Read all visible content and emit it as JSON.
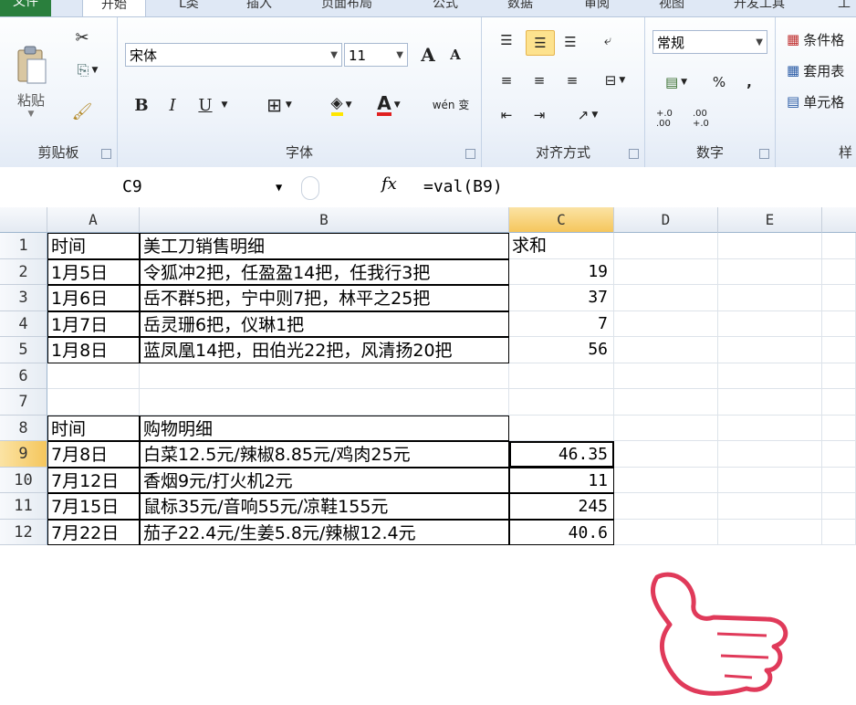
{
  "ribbon": {
    "tabs": [
      "文件",
      "开始",
      "L类",
      "插入",
      "页面布局",
      "公式",
      "数据",
      "审阅",
      "视图",
      "开发工具",
      "工"
    ],
    "clipboard": {
      "paste_label": "粘贴",
      "group_label": "剪贴板"
    },
    "font": {
      "name": "宋体",
      "size": "11",
      "bold": "B",
      "italic": "I",
      "underline": "U",
      "color_glyph": "A",
      "wen_glyph": "wén 变",
      "group_label": "字体",
      "grow": "A",
      "shrink": "A"
    },
    "alignment": {
      "group_label": "对齐方式"
    },
    "number": {
      "format": "常规",
      "percent": "%",
      "comma": ",",
      "inc_dec": "+.0 .00",
      "dec_dec": ".00 +.0",
      "group_label": "数字"
    },
    "styles": {
      "cond_label": "条件格",
      "table_label": "套用表",
      "cell_label": "单元格",
      "group_label": "样"
    }
  },
  "formula_bar": {
    "name_box": "C9",
    "fx": "fx",
    "formula": "=val(B9)"
  },
  "sheet": {
    "columns": [
      "A",
      "B",
      "C",
      "D",
      "E"
    ],
    "active_column": "C",
    "active_row": "9",
    "rows": [
      {
        "num": "1",
        "a": "时间",
        "b": "美工刀销售明细",
        "c": "求和"
      },
      {
        "num": "2",
        "a": "1月5日",
        "b": "令狐冲2把，任盈盈14把，任我行3把",
        "c": "19"
      },
      {
        "num": "3",
        "a": "1月6日",
        "b": "岳不群5把，宁中则7把，林平之25把",
        "c": "37"
      },
      {
        "num": "4",
        "a": "1月7日",
        "b": "岳灵珊6把，仪琳1把",
        "c": "7"
      },
      {
        "num": "5",
        "a": "1月8日",
        "b": "蓝凤凰14把，田伯光22把，风清扬20把",
        "c": "56"
      },
      {
        "num": "6",
        "a": "",
        "b": "",
        "c": ""
      },
      {
        "num": "7",
        "a": "",
        "b": "",
        "c": ""
      },
      {
        "num": "8",
        "a": "时间",
        "b": "购物明细",
        "c": ""
      },
      {
        "num": "9",
        "a": "7月8日",
        "b": "白菜12.5元/辣椒8.85元/鸡肉25元",
        "c": "46.35"
      },
      {
        "num": "10",
        "a": "7月12日",
        "b": "香烟9元/打火机2元",
        "c": "11"
      },
      {
        "num": "11",
        "a": "7月15日",
        "b": "鼠标35元/音响55元/凉鞋155元",
        "c": "245"
      },
      {
        "num": "12",
        "a": "7月22日",
        "b": "茄子22.4元/生姜5.8元/辣椒12.4元",
        "c": "40.6"
      }
    ]
  },
  "colors": {
    "file_tab": "#2a7f3d",
    "highlight": "#f5c65c",
    "thumb_stroke": "#e03a5a"
  }
}
